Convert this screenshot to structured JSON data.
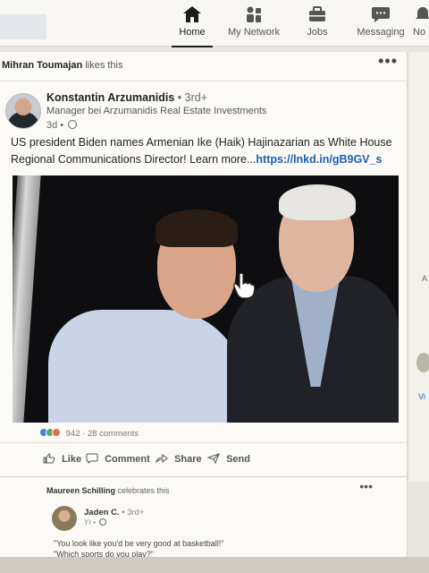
{
  "nav": {
    "items": [
      {
        "label": "Home",
        "icon": "home-icon",
        "active": true
      },
      {
        "label": "My Network",
        "icon": "network-icon"
      },
      {
        "label": "Jobs",
        "icon": "briefcase-icon"
      },
      {
        "label": "Messaging",
        "icon": "chat-icon"
      },
      {
        "label": "No",
        "icon": "bell-icon"
      }
    ]
  },
  "post": {
    "social_actor": "Mihran Toumajan",
    "social_action": "likes this",
    "more": "•••",
    "author_name": "Konstantin Arzumanidis",
    "author_degree": "• 3rd+",
    "author_headline": "Manager bei Arzumanidis Real Estate Investments",
    "posted_ago": "3d •",
    "text_line1": "US president Biden names Armenian Ike (Haik) Hajinazarian as White House",
    "text_line2": "Regional Communications Director! Learn more...",
    "link": "https://lnkd.in/gB9GV_s",
    "reaction_count": "942",
    "comments_count": "· 28 comments",
    "actions": {
      "like": "Like",
      "comment": "Comment",
      "share": "Share",
      "send": "Send"
    }
  },
  "post2": {
    "social_actor": "Maureen Schilling",
    "social_action": "celebrates this",
    "more": "•••",
    "author_name": "Jaden C.",
    "author_degree": "• 3rd+",
    "meta": "Yr •",
    "quote_line1": "\"You look like you'd be very good at basketball!\"",
    "quote_line2": "\"Which sports do you play?\""
  },
  "sidebar": {
    "frag_a": "A",
    "frag_vi": "Vi"
  },
  "colors": {
    "link": "#1a5fb0",
    "nav_bg": "#f7f6f2",
    "card_bg": "#fbfaf6"
  }
}
